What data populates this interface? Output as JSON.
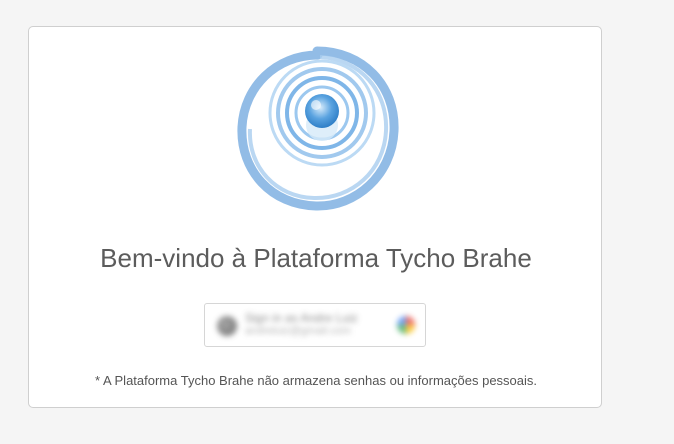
{
  "login": {
    "welcome_text": "Bem-vindo à Plataforma Tycho Brahe",
    "signin_button": {
      "line1": "Sign in as Andre Luiz",
      "line2": "andreluiz@gmail.com"
    },
    "disclaimer": "* A Plataforma Tycho Brahe não armazena senhas ou informações pessoais."
  },
  "colors": {
    "logo_blue": "#4a90d9",
    "logo_light": "#a9cdef",
    "text": "#5c5c5c"
  },
  "icons": {
    "logo": "tycho-brahe-swirl-logo",
    "google": "google-g-icon",
    "avatar": "user-avatar"
  }
}
